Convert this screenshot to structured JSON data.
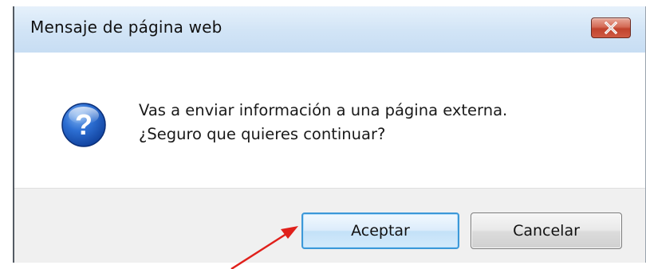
{
  "dialog": {
    "title": "Mensaje de página web",
    "close_icon": "close-icon",
    "icon": "question-icon",
    "message_line1": "Vas a enviar información a una página externa.",
    "message_line2": "¿Seguro que quieres continuar?",
    "ok_label": "Aceptar",
    "cancel_label": "Cancelar"
  },
  "annotation": {
    "arrow_color": "#e0201b",
    "points_to": "ok-button"
  },
  "colors": {
    "titlebar": "#d1e4f6",
    "close_button": "#c0432d",
    "ok_border": "#3c98d8",
    "footer": "#f0f0f0"
  }
}
